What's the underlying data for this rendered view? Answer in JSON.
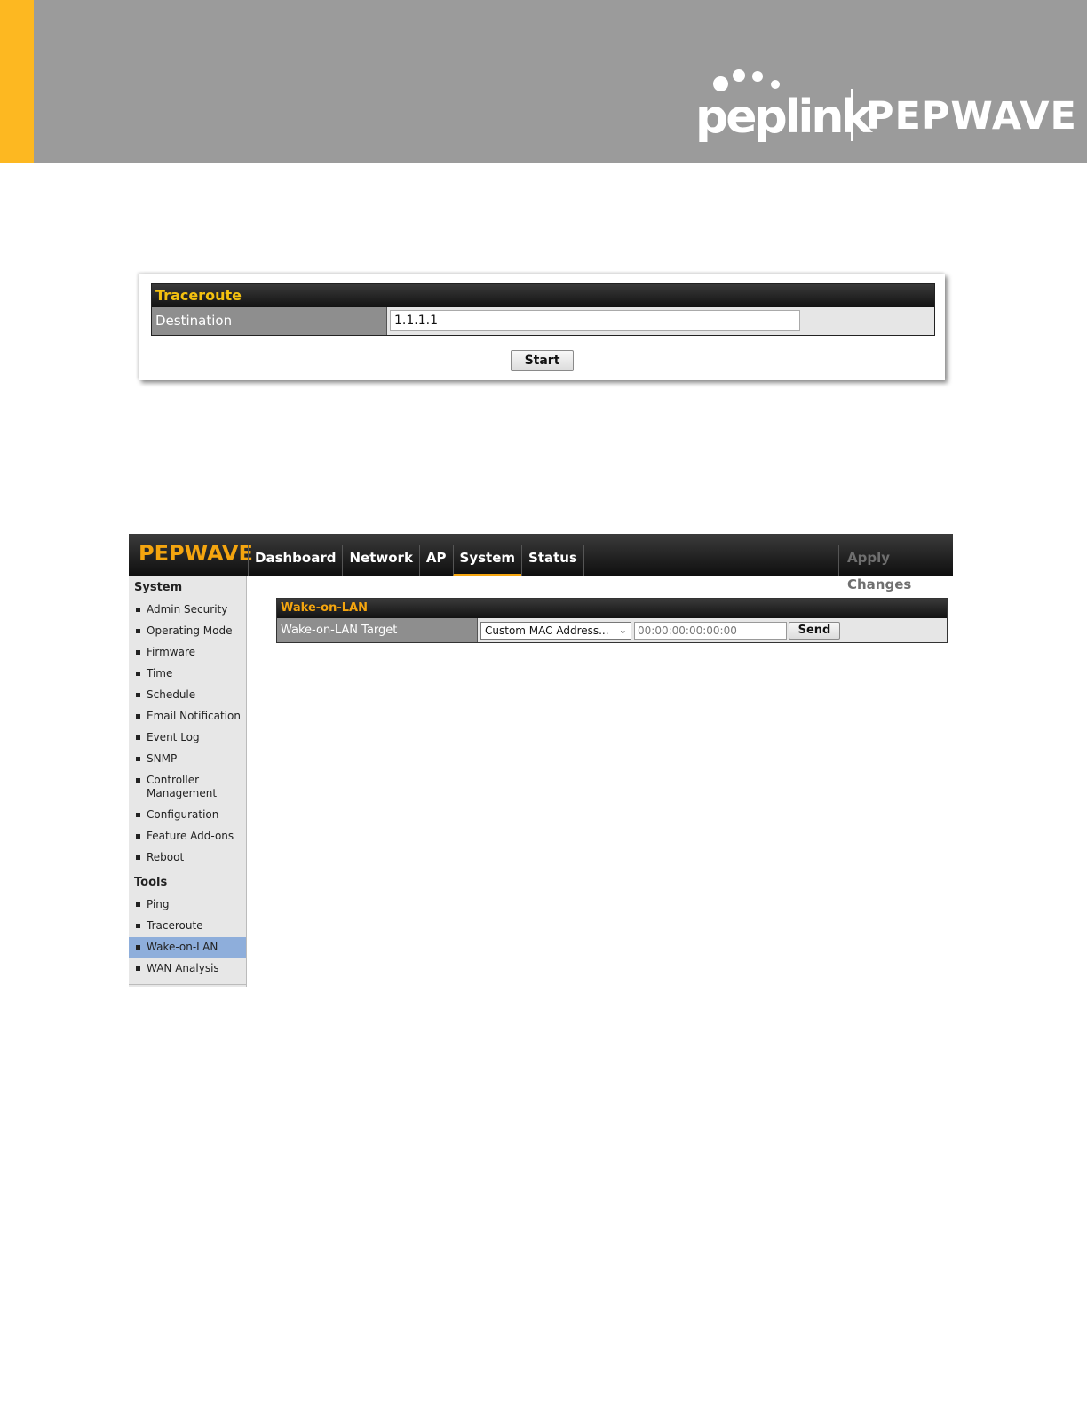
{
  "banner": {
    "accent_color": "#fdb821",
    "background_color": "#9b9b9b",
    "logo_peplink": "peplink",
    "logo_pepwave": "PEPWAVE"
  },
  "traceroute": {
    "title": "Traceroute",
    "destination_label": "Destination",
    "destination_value": "1.1.1.1",
    "start_label": "Start"
  },
  "wol_app": {
    "logo": "PEPWAVE",
    "nav": {
      "tabs": [
        {
          "label": "Dashboard"
        },
        {
          "label": "Network"
        },
        {
          "label": "AP"
        },
        {
          "label": "System"
        },
        {
          "label": "Status"
        }
      ],
      "active_tab": "System",
      "apply_label": "Apply Changes"
    },
    "sidebar": {
      "system_heading": "System",
      "system_items": [
        {
          "label": "Admin Security"
        },
        {
          "label": "Operating Mode"
        },
        {
          "label": "Firmware"
        },
        {
          "label": "Time"
        },
        {
          "label": "Schedule"
        },
        {
          "label": "Email Notification"
        },
        {
          "label": "Event Log"
        },
        {
          "label": "SNMP"
        },
        {
          "label": "Controller Management"
        },
        {
          "label": "Configuration"
        },
        {
          "label": "Feature Add-ons"
        },
        {
          "label": "Reboot"
        }
      ],
      "tools_heading": "Tools",
      "tools_items": [
        {
          "label": "Ping"
        },
        {
          "label": "Traceroute"
        },
        {
          "label": "Wake-on-LAN"
        },
        {
          "label": "WAN Analysis"
        }
      ],
      "active_item": "Wake-on-LAN"
    },
    "wake_on_lan": {
      "title": "Wake-on-LAN",
      "target_label": "Wake-on-LAN Target",
      "target_select_value": "Custom MAC Address...",
      "mac_placeholder": "00:00:00:00:00:00",
      "send_label": "Send"
    },
    "colors": {
      "accent": "#f4a50f",
      "sidebar_active": "#8eaedb"
    }
  }
}
